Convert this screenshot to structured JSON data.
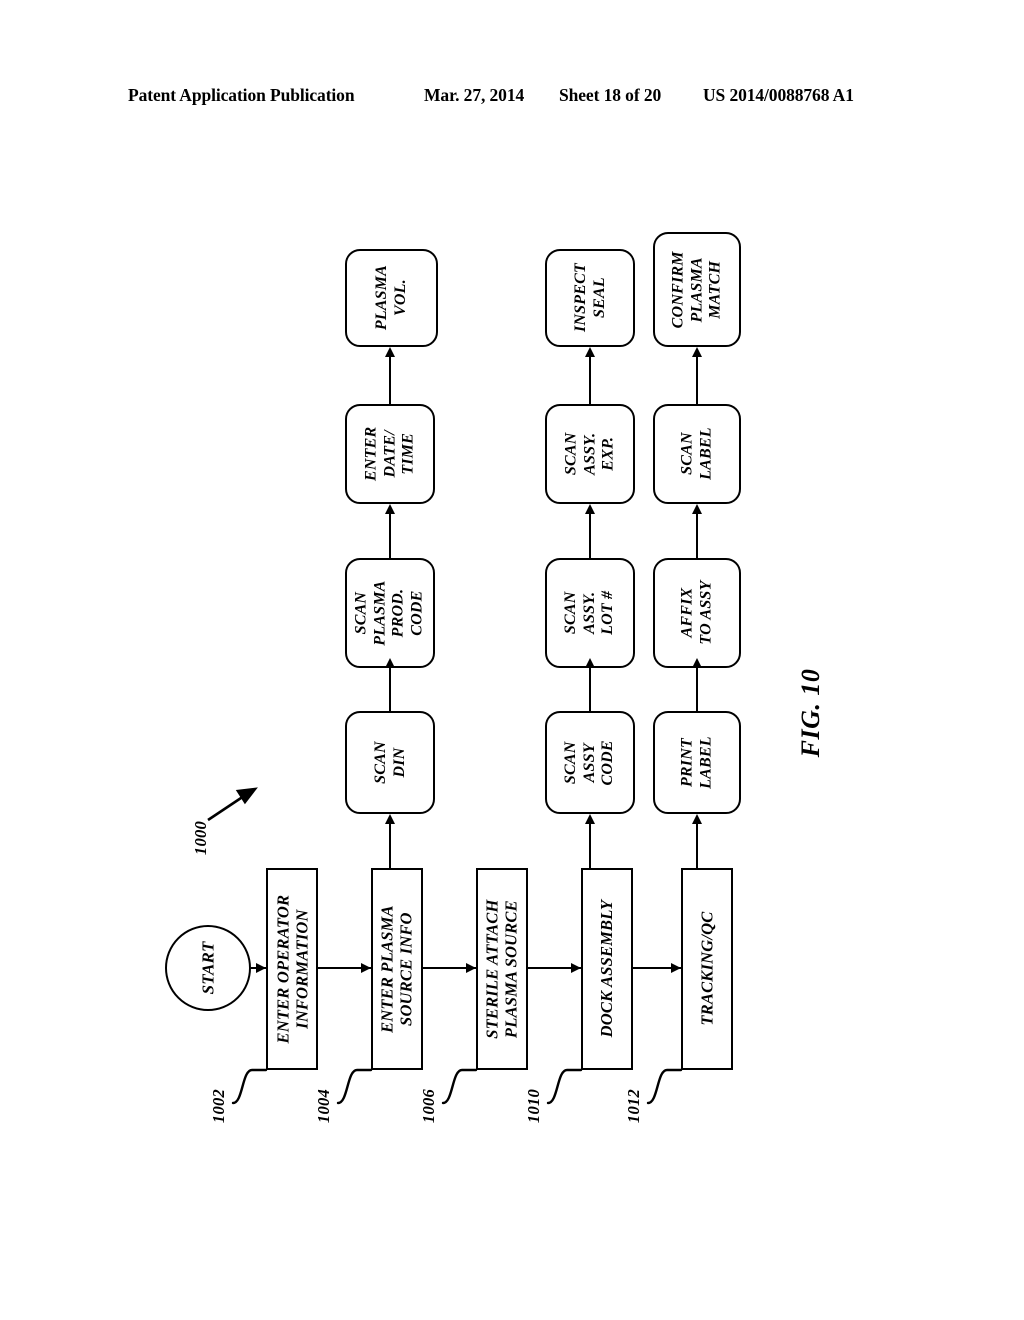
{
  "header": {
    "publication": "Patent Application Publication",
    "date": "Mar. 27, 2014",
    "sheet": "Sheet 18 of 20",
    "patent_number": "US 2014/0088768 A1"
  },
  "figure": {
    "caption": "FIG. 10",
    "diagram_number": "1000",
    "start_label": "START"
  },
  "nodes": {
    "enter_operator_information": "ENTER OPERATOR\nINFORMATION",
    "enter_plasma_source_info": "ENTER PLASMA\nSOURCE INFO",
    "sterile_attach_plasma_source": "STERILE ATTACH\nPLASMA SOURCE",
    "dock_assembly": "DOCK ASSEMBLY",
    "tracking_qc": "TRACKING/QC",
    "scan_din": "SCAN\nDIN",
    "scan_plasma_prod_code": "SCAN\nPLASMA\nPROD.\nCODE",
    "enter_date_time": "ENTER\nDATE/\nTIME",
    "plasma_vol": "PLASMA\nVOL.",
    "scan_assy_code": "SCAN\nASSY\nCODE",
    "scan_assy_lot": "SCAN\nASSY.\nLOT #",
    "scan_assy_exp": "SCAN\nASSY.\nEXP.",
    "inspect_seal": "INSPECT\nSEAL",
    "print_label": "PRINT\nLABEL",
    "affix_to_assy": "AFFIX\nTO ASSY",
    "scan_label": "SCAN\nLABEL",
    "confirm_plasma_match": "CONFIRM\nPLASMA\nMATCH"
  },
  "reference_numerals": {
    "n1002": "1002",
    "n1004": "1004",
    "n1006": "1006",
    "n1010": "1010",
    "n1012": "1012"
  },
  "colors": {
    "line": "#000000",
    "background": "#ffffff"
  }
}
